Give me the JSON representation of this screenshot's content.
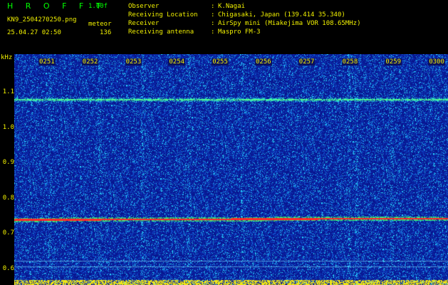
{
  "header": {
    "app_title": "H R O F F T",
    "version": "1.00f",
    "filename": "KN9_2504270250.png",
    "mode": "meteor",
    "timestamp": "25.04.27 02:50",
    "count": "136",
    "info": [
      {
        "label": "Observer",
        "value": "K.Nagai"
      },
      {
        "label": "Receiving Location",
        "value": "Chigasaki, Japan (139.414 35.340)"
      },
      {
        "label": "Receiver",
        "value": "AirSpy mini (Miakejima VOR 108.65MHz)"
      },
      {
        "label": "Receiving antenna",
        "value": "Maspro FM-3"
      }
    ]
  },
  "spectrogram": {
    "unit": "kHz",
    "y_ticks": [
      "1.1",
      "1.0",
      "0.9",
      "0.8",
      "0.7",
      "0.6"
    ],
    "time_ticks": [
      "0251",
      "0252",
      "0253",
      "0254",
      "0255",
      "0256",
      "0257",
      "0258",
      "0259",
      "0300"
    ],
    "trace_freq_khz": 0.74,
    "upper_line_freq_khz": 1.08,
    "colors": {
      "background": "#0a1a9a",
      "trace": "#ff3030",
      "line": "#40ff80",
      "noise": "#20c0ff"
    }
  }
}
